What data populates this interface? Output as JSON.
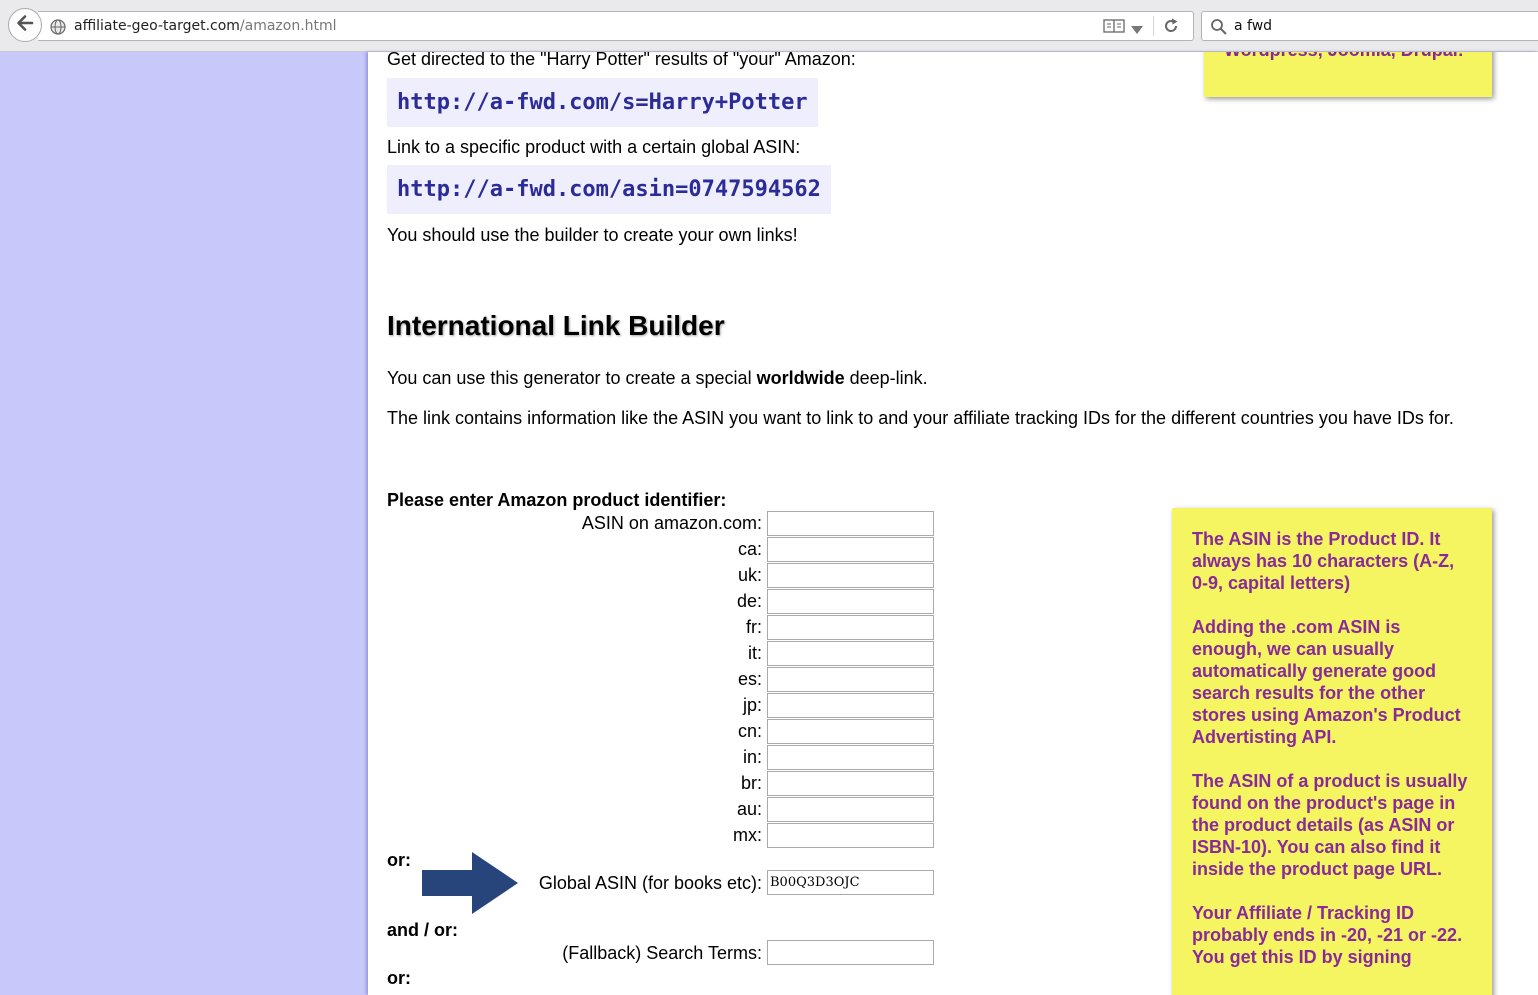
{
  "browser": {
    "url_domain": "affiliate-geo-target.com",
    "url_path": "/amazon.html",
    "search_query": "a fwd"
  },
  "intro": {
    "line1": "Get directed to the \"Harry Potter\" results of \"your\" Amazon:",
    "code1": "http://a-fwd.com/s=Harry+Potter",
    "line2": "Link to a specific product with a certain global ASIN:",
    "code2": "http://a-fwd.com/asin=0747594562",
    "line3": "You should use the builder to create your own links!"
  },
  "builder": {
    "heading": "International Link Builder",
    "desc1_pre": "You can use this generator to create a special ",
    "desc1_bold": "worldwide",
    "desc1_post": " deep-link.",
    "desc2": "The link contains information like the ASIN you want to link to and your affiliate tracking IDs for the different countries you have IDs for.",
    "form_title": "Please enter Amazon product identifier:",
    "asin_fields": [
      {
        "label": "ASIN on amazon.com:",
        "value": ""
      },
      {
        "label": "ca:",
        "value": ""
      },
      {
        "label": "uk:",
        "value": ""
      },
      {
        "label": "de:",
        "value": ""
      },
      {
        "label": "fr:",
        "value": ""
      },
      {
        "label": "it:",
        "value": ""
      },
      {
        "label": "es:",
        "value": ""
      },
      {
        "label": "jp:",
        "value": ""
      },
      {
        "label": "cn:",
        "value": ""
      },
      {
        "label": "in:",
        "value": ""
      },
      {
        "label": "br:",
        "value": ""
      },
      {
        "label": "au:",
        "value": ""
      },
      {
        "label": "mx:",
        "value": ""
      }
    ],
    "or1": "or:",
    "global_asin_label": "Global ASIN (for books etc):",
    "global_asin_value": "B00Q3D3OJC",
    "and_or": "and / or:",
    "fallback_label": "(Fallback) Search Terms:",
    "fallback_value": "",
    "or2": "or:"
  },
  "notes": {
    "top_partial": "Wordpress, Joomla, Drupal!",
    "asin_paragraphs": [
      "The ASIN is the Product ID. It always has 10 characters (A-Z, 0-9, capital letters)",
      "Adding the .com ASIN is enough, we can usually automatically generate good search results for the other stores using Amazon's Product Advertisting API.",
      "The ASIN of a product is usually found on the product's page in the product details (as ASIN or ISBN-10). You can also find it inside the product page URL.",
      "Your Affiliate / Tracking ID probably ends in -20, -21 or -22. You get this ID by signing"
    ]
  },
  "colors": {
    "page_bg": "#c8c8fa",
    "code_text": "#2c2c99",
    "note_bg": "#f5f562",
    "note_text": "#8a2a9a",
    "arrow": "#27457a"
  }
}
